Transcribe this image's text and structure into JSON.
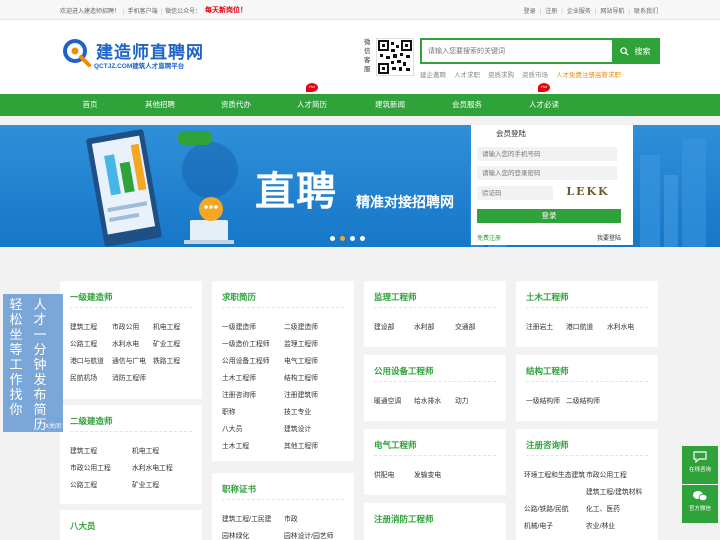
{
  "topbar": {
    "welcome": "欢迎进入建造师招聘！",
    "mobile": "手机客户端",
    "wechat": "微信公众号：",
    "hot": "每天新岗位！",
    "links": [
      "登录",
      "注册",
      "企业服务",
      "网站导航",
      "联系我们"
    ]
  },
  "header": {
    "logo_name": "建造师直聘网",
    "logo_sub": "QCTJZ.COM建筑人才直聘平台",
    "wechat_label": "微信客服",
    "search_placeholder": "请输入您要搜索的关键词",
    "search_button": "搜索",
    "hotwords": [
      "建企邀聘",
      "人才求职",
      "资质求购",
      "资质市场"
    ],
    "promo": "人才免费注册高薪求职"
  },
  "nav": {
    "items": [
      "首页",
      "其他招聘",
      "资质代办",
      "人才简历",
      "建筑新闻",
      "会员服务",
      "人才必读"
    ],
    "badge": "Hot"
  },
  "banner": {
    "headline": "直聘",
    "slogan": "精准对接招聘网"
  },
  "login": {
    "title": "会员登陆",
    "phone_placeholder": "请输入您的手机号码",
    "password_placeholder": "请输入您的登录密码",
    "captcha_placeholder": "验证码",
    "captcha_text": "LEKK",
    "submit": "登录",
    "register": "免费注册",
    "mine": "我要登陆"
  },
  "float_left": {
    "col1": "轻松坐等工作找你",
    "col2": "人才一分钟发布简历",
    "close": "X关闭"
  },
  "float_right": {
    "consult": "在线咨询",
    "wechat": "官方微信"
  },
  "cards": {
    "yijian": {
      "title": "一级建造师",
      "items": [
        "建筑工程",
        "市政公用",
        "机电工程",
        "公路工程",
        "水利水电",
        "矿业工程",
        "港口与航道",
        "通信与广电",
        "铁路工程",
        "民航机场",
        "消防工程师"
      ]
    },
    "erjian": {
      "title": "二级建造师",
      "items": [
        "建筑工程",
        "机电工程",
        "市政公用工程",
        "水利水电工程",
        "公路工程",
        "矿业工程"
      ]
    },
    "bada": {
      "title": "八大员"
    },
    "qiuzhi": {
      "title": "求职简历",
      "items": [
        "一级建造师",
        "二级建造师",
        "一级造价工程师",
        "监理工程师",
        "公用设备工程师",
        "电气工程师",
        "土木工程师",
        "结构工程师",
        "注册咨询师",
        "注册建筑师",
        "职称",
        "技工专业",
        "八大员",
        "建筑设计",
        "土木工程",
        "其他工程师"
      ]
    },
    "zhicheng": {
      "title": "职称证书",
      "items": [
        "建筑工程/工民建",
        "市政",
        "园林绿化",
        "园林设计/园艺师"
      ]
    },
    "jianli": {
      "title": "监理工程师",
      "items": [
        "建设部",
        "水利部",
        "交通部"
      ]
    },
    "gongyong": {
      "title": "公用设备工程师",
      "items": [
        "暖通空调",
        "给水排水",
        "动力"
      ]
    },
    "dianqi": {
      "title": "电气工程师",
      "items": [
        "供配电",
        "发输变电"
      ]
    },
    "xiaofang": {
      "title": "注册消防工程师"
    },
    "tumu": {
      "title": "土木工程师",
      "items": [
        "注册岩土",
        "港口航道",
        "水利水电"
      ]
    },
    "jiegou": {
      "title": "结构工程师",
      "items": [
        "一级结构师",
        "二级结构师"
      ]
    },
    "zixun": {
      "title": "注册咨询师",
      "items": [
        "环境工程和生态建筑",
        "市政公用工程",
        "建筑工程/建筑材料",
        "公路/铁路/民航",
        "化工、医药",
        "机械/电子",
        "农业/林业"
      ]
    }
  }
}
